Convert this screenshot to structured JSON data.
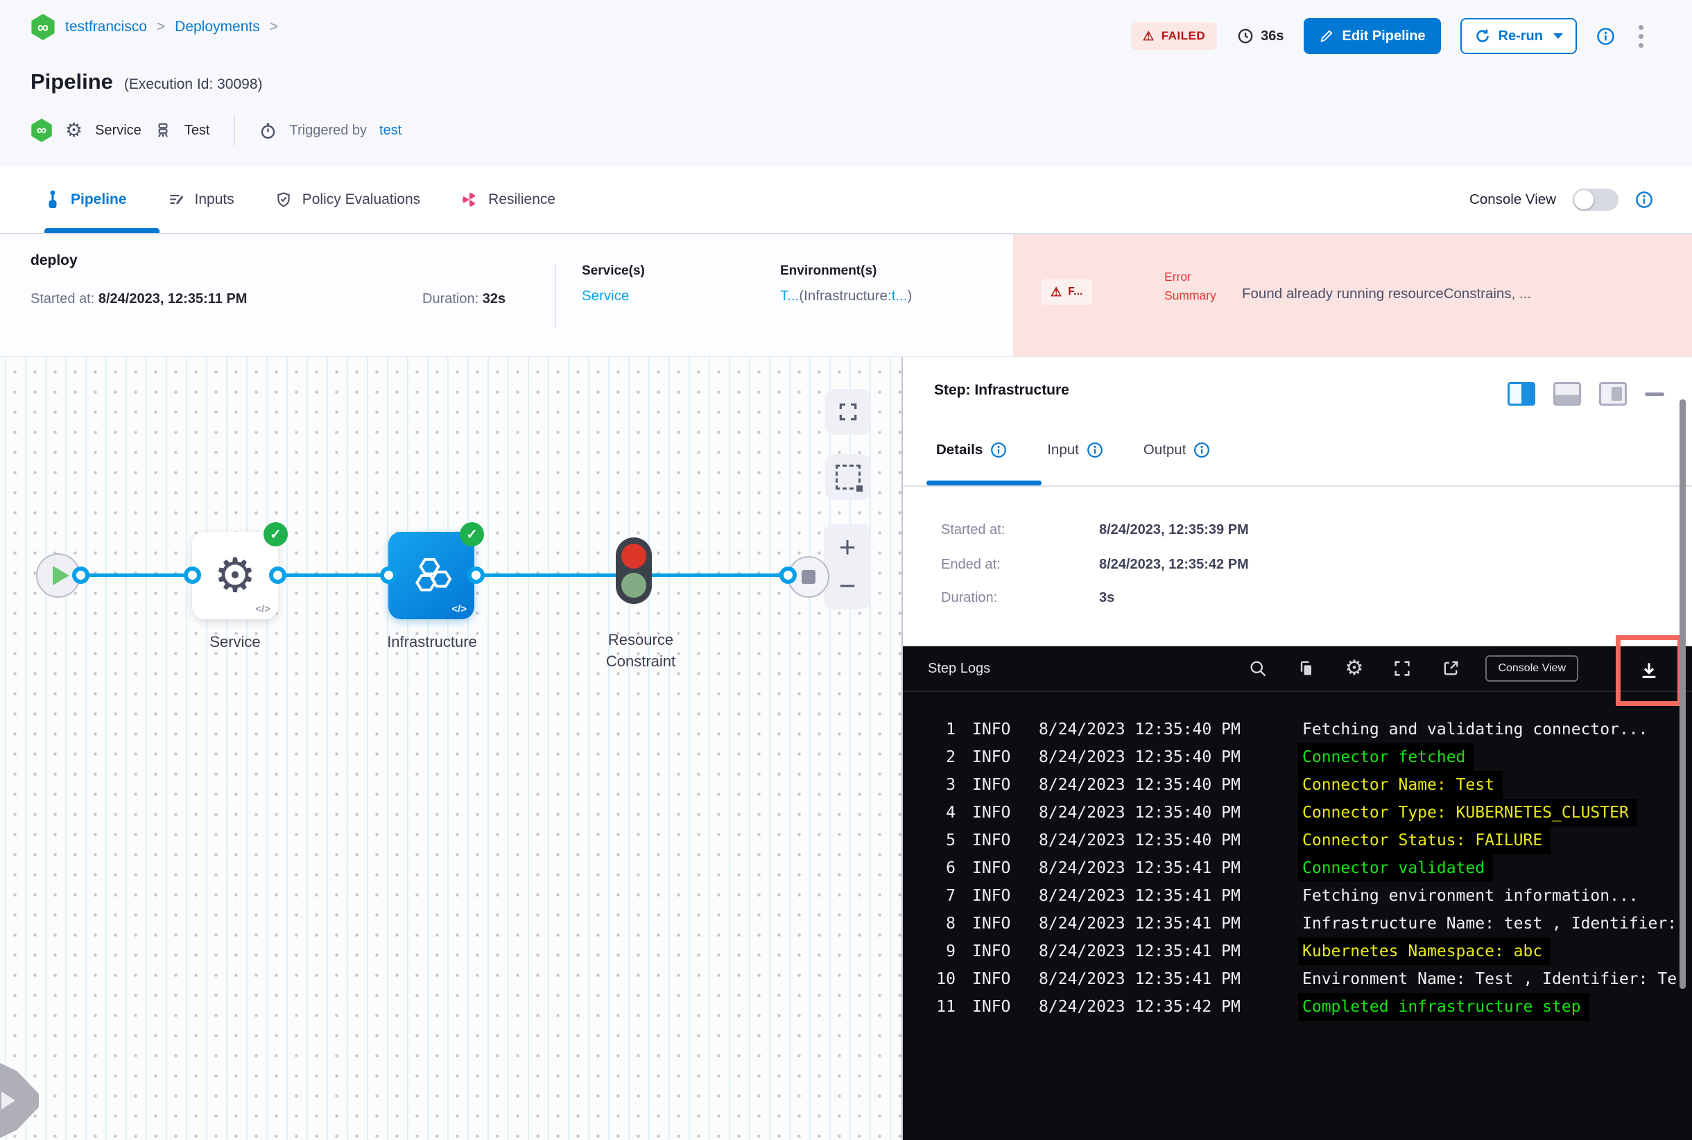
{
  "breadcrumb": {
    "items": [
      "testfrancisco",
      "Deployments"
    ],
    "separator": ">"
  },
  "header": {
    "title": "Pipeline",
    "execution_id": "(Execution Id: 30098)",
    "status_badge": "FAILED",
    "warn_glyph": "⚠",
    "elapsed": "36s",
    "edit_pipeline": "Edit Pipeline",
    "rerun": "Re-run",
    "meta": {
      "service": "Service",
      "environment": "Test",
      "triggered_by_label": "Triggered by",
      "triggered_by_user": "test"
    }
  },
  "tabbar": {
    "tabs": [
      {
        "label": "Pipeline",
        "active": true
      },
      {
        "label": "Inputs",
        "active": false
      },
      {
        "label": "Policy Evaluations",
        "active": false
      },
      {
        "label": "Resilience",
        "active": false
      }
    ],
    "console_view_label": "Console View"
  },
  "stage": {
    "name": "deploy",
    "started_label": "Started at:",
    "started": "8/24/2023, 12:35:11 PM",
    "duration_label": "Duration:",
    "duration": "32s",
    "services_label": "Service(s)",
    "services_value": "Service",
    "environments_label": "Environment(s)",
    "env_link1": "T...",
    "env_mid": "(Infrastructure:",
    "env_link2": "t...",
    "env_close": ")",
    "error_chip": "F...",
    "error_label": "Error Summary",
    "error_message": "Found already running resourceConstrains, ..."
  },
  "graph": {
    "nodes": [
      {
        "label": "Service"
      },
      {
        "label": "Infrastructure"
      },
      {
        "label": "Resource Constraint"
      }
    ],
    "code_badge": "</>",
    "zoom_in": "+",
    "zoom_out": "−",
    "check_glyph": "✓"
  },
  "step_panel": {
    "title": "Step: Infrastructure",
    "tabs": [
      {
        "label": "Details",
        "active": true
      },
      {
        "label": "Input",
        "active": false
      },
      {
        "label": "Output",
        "active": false
      }
    ],
    "details": {
      "started_label": "Started at:",
      "started": "8/24/2023, 12:35:39 PM",
      "ended_label": "Ended at:",
      "ended": "8/24/2023, 12:35:42 PM",
      "duration_label": "Duration:",
      "duration": "3s"
    }
  },
  "logs": {
    "title": "Step Logs",
    "console_view_button": "Console View",
    "lines": [
      {
        "num": "1",
        "level": "INFO",
        "time": "8/24/2023 12:35:40 PM",
        "msg": "Fetching and validating connector...",
        "color": "white"
      },
      {
        "num": "2",
        "level": "INFO",
        "time": "8/24/2023 12:35:40 PM",
        "msg": "Connector fetched",
        "color": "green"
      },
      {
        "num": "3",
        "level": "INFO",
        "time": "8/24/2023 12:35:40 PM",
        "msg": "Connector Name: Test",
        "color": "yellow"
      },
      {
        "num": "4",
        "level": "INFO",
        "time": "8/24/2023 12:35:40 PM",
        "msg": "Connector Type: KUBERNETES_CLUSTER",
        "color": "yellow"
      },
      {
        "num": "5",
        "level": "INFO",
        "time": "8/24/2023 12:35:40 PM",
        "msg": "Connector Status: FAILURE",
        "color": "yellow"
      },
      {
        "num": "6",
        "level": "INFO",
        "time": "8/24/2023 12:35:41 PM",
        "msg": "Connector validated",
        "color": "green"
      },
      {
        "num": "7",
        "level": "INFO",
        "time": "8/24/2023 12:35:41 PM",
        "msg": "Fetching environment information...",
        "color": "white"
      },
      {
        "num": "8",
        "level": "INFO",
        "time": "8/24/2023 12:35:41 PM",
        "msg": "Infrastructure Name: test , Identifier:",
        "color": "white"
      },
      {
        "num": "9",
        "level": "INFO",
        "time": "8/24/2023 12:35:41 PM",
        "msg": "Kubernetes Namespace: abc",
        "color": "yellow"
      },
      {
        "num": "10",
        "level": "INFO",
        "time": "8/24/2023 12:35:41 PM",
        "msg": "Environment Name: Test , Identifier: Te",
        "color": "white"
      },
      {
        "num": "11",
        "level": "INFO",
        "time": "8/24/2023 12:35:42 PM",
        "msg": "Completed infrastructure step",
        "color": "green"
      }
    ]
  },
  "colors": {
    "primary_blue": "#0278d5",
    "link_blue": "#0aa3e8",
    "failed_red": "#b41710",
    "error_bg": "#fbe3e2",
    "annotation_red": "#f4695e",
    "log_green": "#16e316",
    "log_yellow": "#e9e918",
    "success_green": "#21b14c"
  }
}
